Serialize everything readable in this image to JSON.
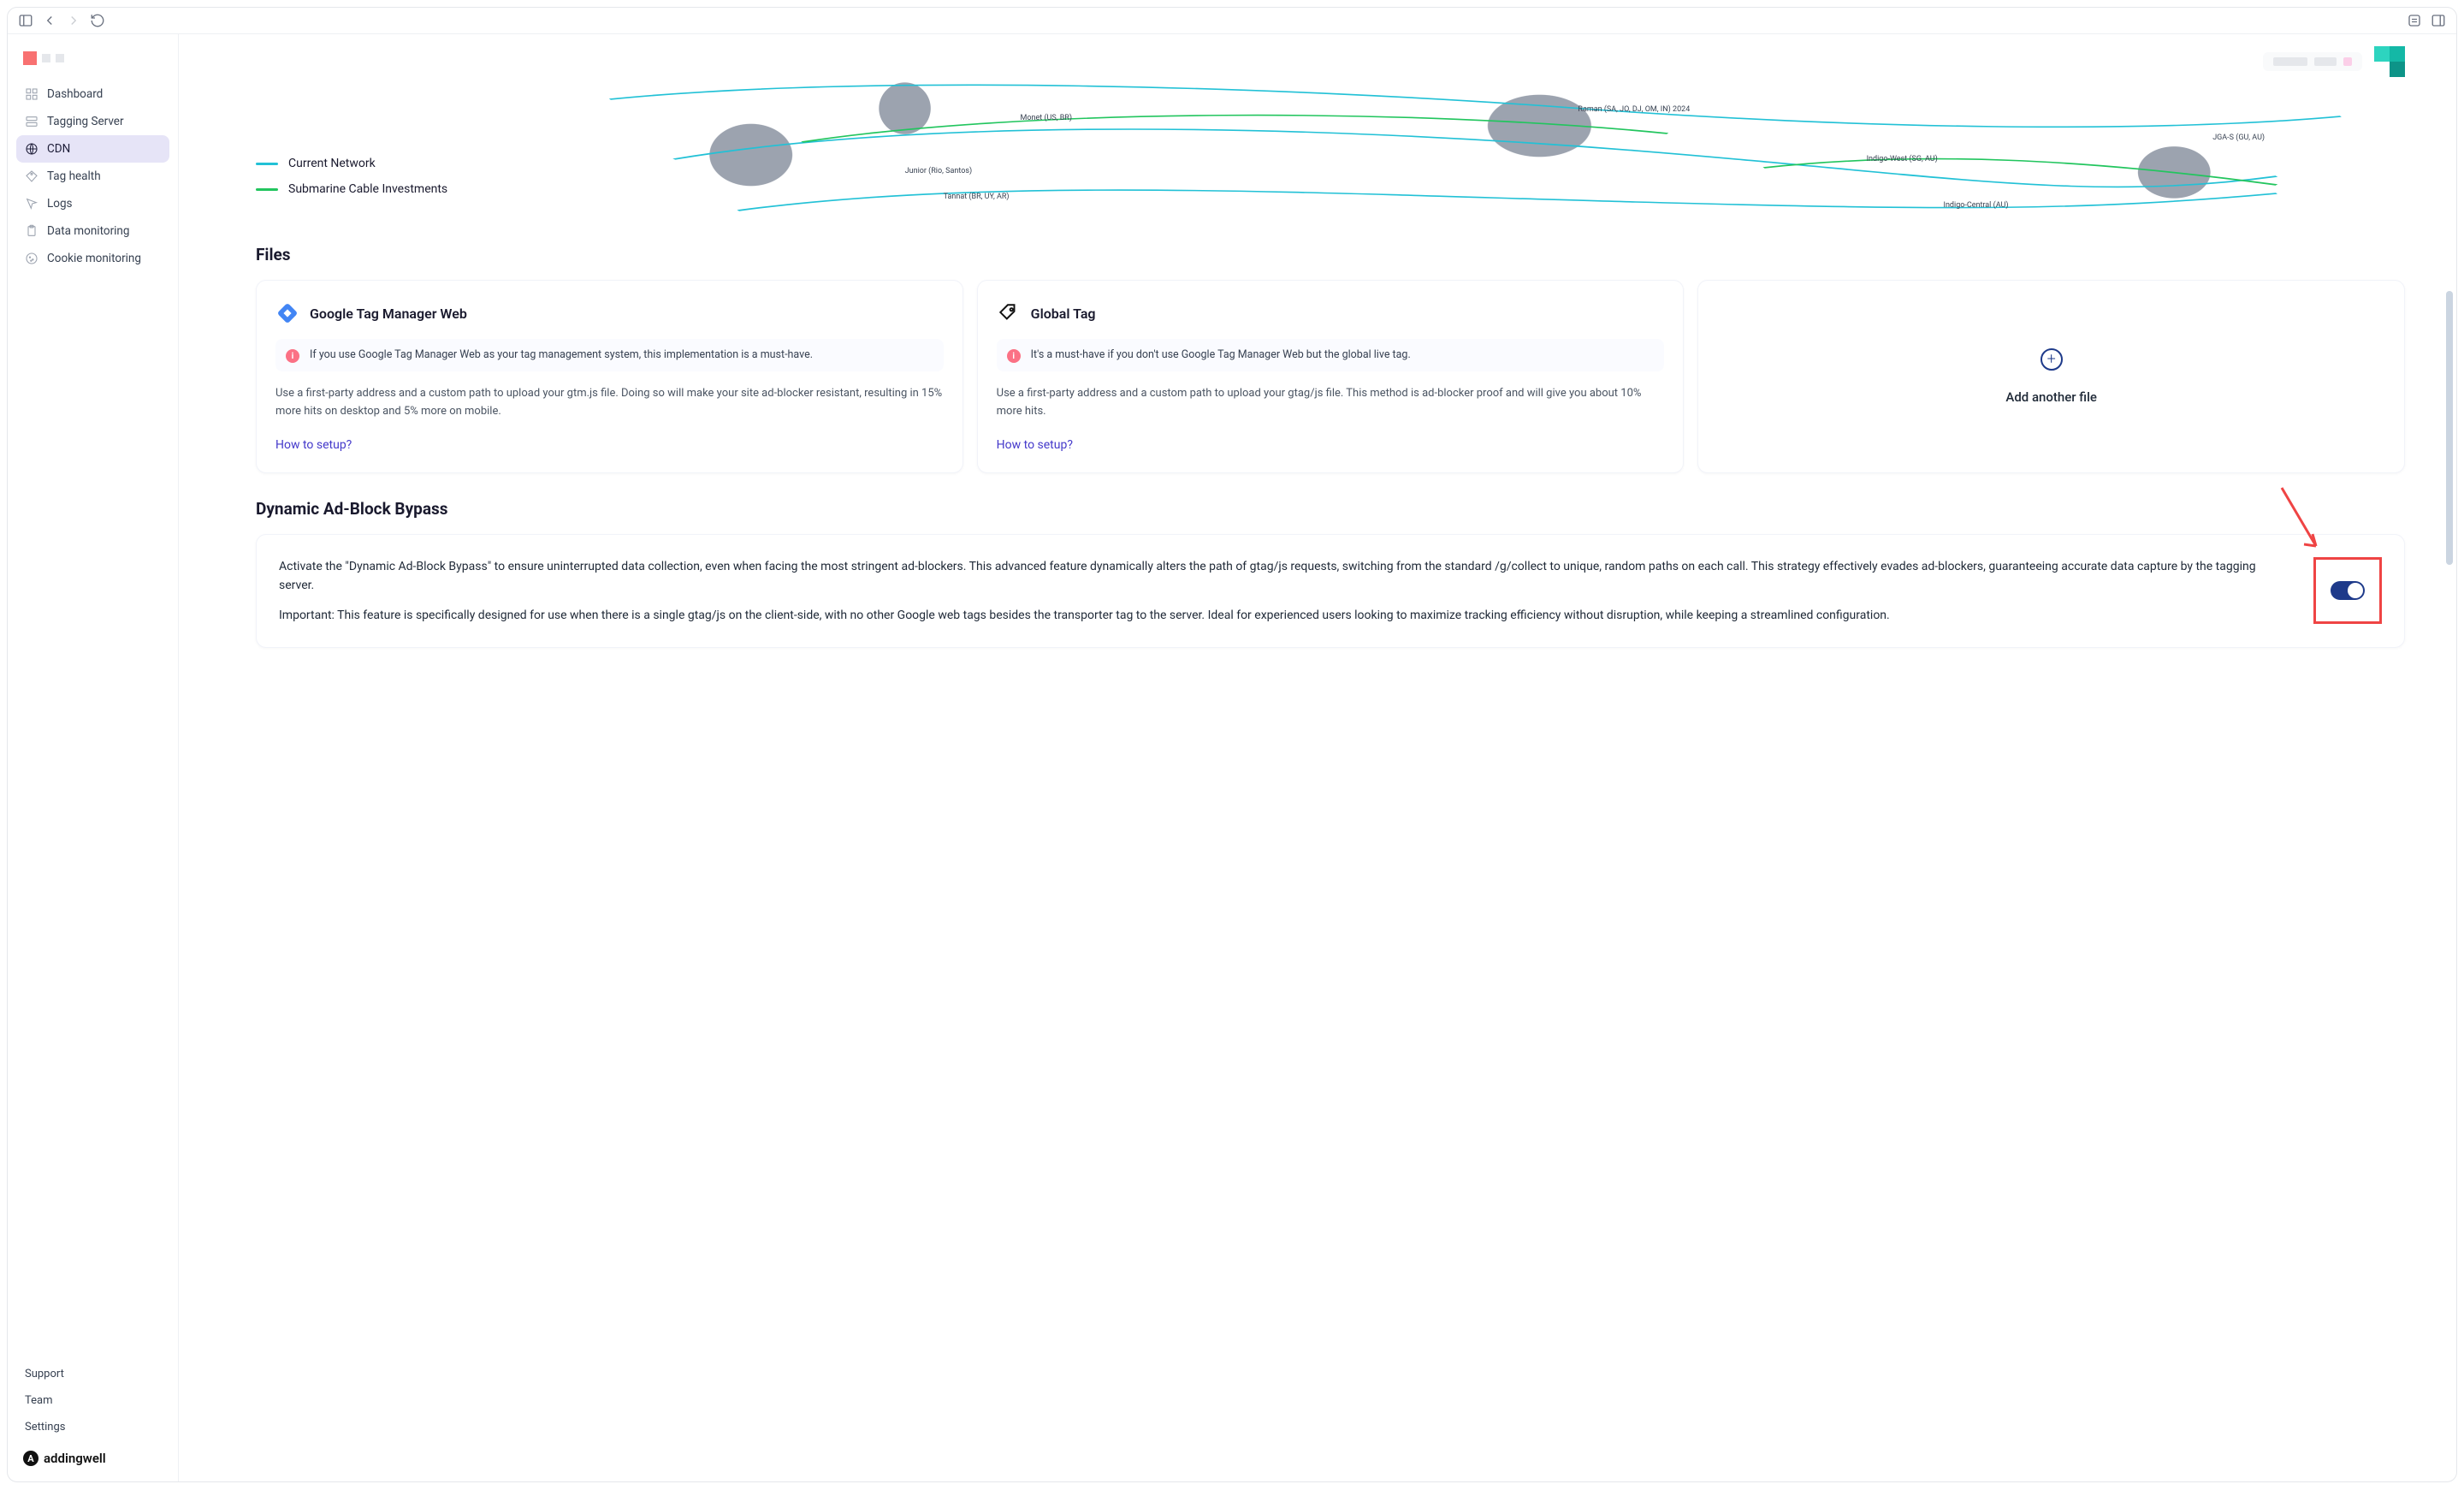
{
  "sidebar": {
    "items": [
      {
        "label": "Dashboard"
      },
      {
        "label": "Tagging Server"
      },
      {
        "label": "CDN"
      },
      {
        "label": "Tag health"
      },
      {
        "label": "Logs"
      },
      {
        "label": "Data monitoring"
      },
      {
        "label": "Cookie monitoring"
      }
    ],
    "bottom": {
      "support": "Support",
      "team": "Team",
      "settings": "Settings"
    },
    "brand": "addingwell"
  },
  "map": {
    "legend": {
      "current": "Current Network",
      "submarine": "Submarine Cable Investments"
    },
    "labels": {
      "monet": "Monet\n(US, BR)",
      "junior": "Junior (Rio, Santos)",
      "tannat": "Tannat (BR, UY, AR)",
      "raman": "Raman (SA, JO,\nDJ, OM, IN)\n2024",
      "indigoWest": "Indigo-West\n(SG, AU)",
      "jgas": "JGA-S (GU, AU)",
      "indigoCentral": "Indigo-Central (AU)"
    }
  },
  "files": {
    "heading": "Files",
    "cards": {
      "gtm": {
        "title": "Google Tag Manager Web",
        "info": "If you use Google Tag Manager Web as your tag management system, this implementation is a must-have.",
        "desc": "Use a first-party address and a custom path to upload your gtm.js file. Doing so will make your site ad-blocker resistant, resulting in 15% more hits on desktop and 5% more on mobile.",
        "link": "How to setup?"
      },
      "gtag": {
        "title": "Global Tag",
        "info": "It's a must-have if you don't use Google Tag Manager Web but the global live tag.",
        "desc": "Use a first-party address and a custom path to upload your gtag/js file. This method is ad-blocker proof and will give you about 10% more hits.",
        "link": "How to setup?"
      },
      "add": {
        "label": "Add another file"
      }
    }
  },
  "bypass": {
    "heading": "Dynamic Ad-Block Bypass",
    "p1": "Activate the \"Dynamic Ad-Block Bypass\" to ensure uninterrupted data collection, even when facing the most stringent ad-blockers. This advanced feature dynamically alters the path of gtag/js requests, switching from the standard /g/collect to unique, random paths on each call. This strategy effectively evades ad-blockers, guaranteeing accurate data capture by the tagging server.",
    "p2_prefix": "Important: ",
    "p2": "This feature is specifically designed for use when there is a single gtag/js on the client-side, with no other Google web tags besides the transporter tag to the server. Ideal for experienced users looking to maximize tracking efficiency without disruption, while keeping a streamlined configuration.",
    "toggle_on": true
  }
}
